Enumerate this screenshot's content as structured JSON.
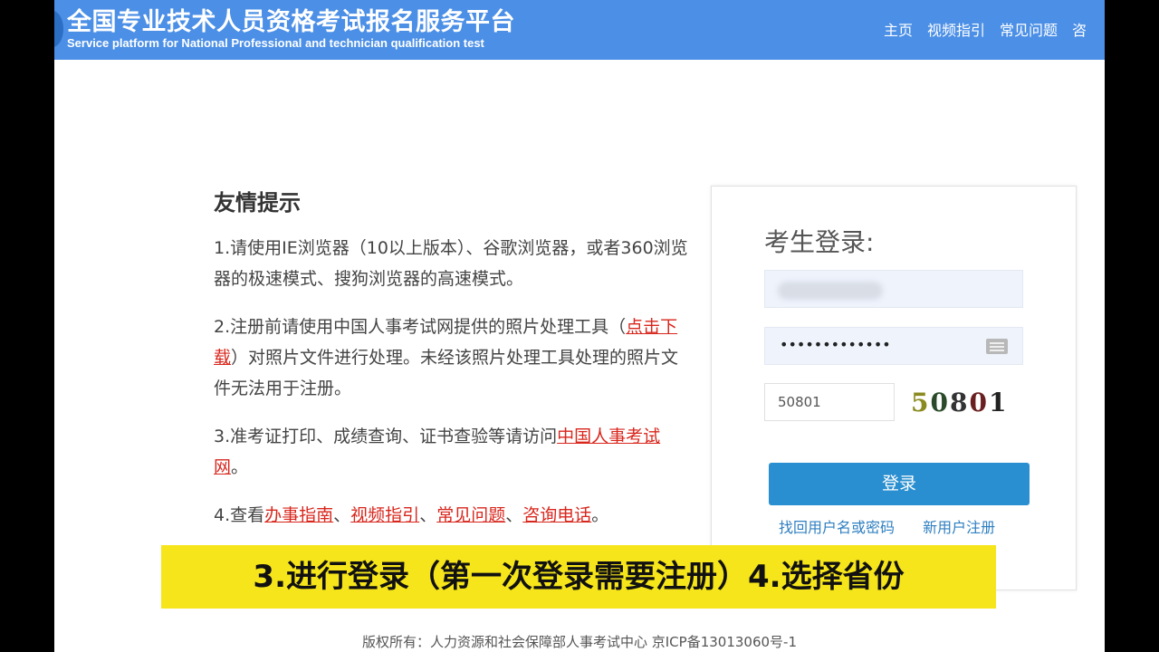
{
  "header": {
    "title": "全国专业技术人员资格考试报名服务平台",
    "subtitle": "Service platform for National Professional and technician qualification test",
    "nav": [
      "主页",
      "视频指引",
      "常见问题",
      "咨"
    ]
  },
  "tips": {
    "heading": "友情提示",
    "p1": "1.请使用IE浏览器（10以上版本）、谷歌浏览器，或者360浏览器的极速模式、搜狗浏览器的高速模式。",
    "p2a": "2.注册前请使用中国人事考试网提供的照片处理工具（",
    "p2link": "点击下载",
    "p2b": "）对照片文件进行处理。未经该照片处理工具处理的照片文件无法用于注册。",
    "p3a": "3.准考证打印、成绩查询、证书查验等请访问",
    "p3link": "中国人事考试网",
    "p3b": "。",
    "p4a": "4.查看",
    "p4links": [
      "办事指南",
      "视频指引",
      "常见问题",
      "咨询电话"
    ],
    "sep": "、",
    "p4end": "。"
  },
  "login": {
    "title": "考生登录:",
    "password_mask": "•••••••••••••",
    "captcha_value": "50801",
    "captcha_chars": [
      "5",
      "0",
      "8",
      "0",
      "1"
    ],
    "submit": "登录",
    "forgot": "找回用户名或密码",
    "register": "新用户注册"
  },
  "caption": "3.进行登录（第一次登录需要注册）4.选择省份",
  "footer": "版权所有：人力资源和社会保障部人事考试中心 京ICP备13013060号-1"
}
